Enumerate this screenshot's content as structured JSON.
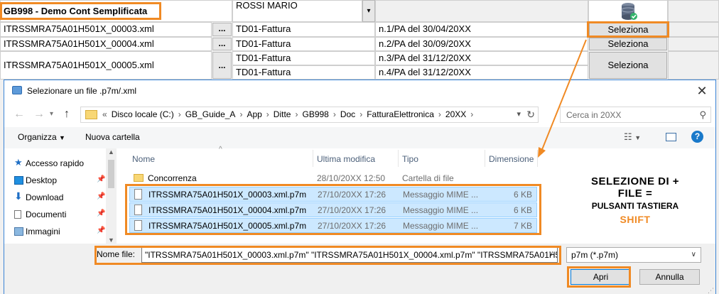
{
  "grid": {
    "company": "GB998 - Demo Cont Semplificata",
    "client": "ROSSI MARIO",
    "dots_label": "...",
    "select_label": "Seleziona",
    "rows": [
      {
        "file": "ITRSSMRA75A01H501X_00003.xml",
        "docs": [
          {
            "type": "TD01-Fattura",
            "ref": "n.1/PA del 30/04/20XX"
          }
        ]
      },
      {
        "file": "ITRSSMRA75A01H501X_00004.xml",
        "docs": [
          {
            "type": "TD01-Fattura",
            "ref": "n.2/PA del 30/09/20XX"
          }
        ]
      },
      {
        "file": "ITRSSMRA75A01H501X_00005.xml",
        "docs": [
          {
            "type": "TD01-Fattura",
            "ref": "n.3/PA del 31/12/20XX"
          },
          {
            "type": "TD01-Fattura",
            "ref": "n.4/PA del 31/12/20XX"
          }
        ]
      }
    ]
  },
  "dialog": {
    "title": "Selezionare un file .p7m/.xml",
    "breadcrumbs": [
      "Disco locale (C:)",
      "GB_Guide_A",
      "App",
      "Ditte",
      "GB998",
      "Doc",
      "FatturaElettronica",
      "20XX"
    ],
    "search_placeholder": "Cerca in 20XX",
    "toolbar": {
      "organize": "Organizza",
      "new_folder": "Nuova cartella"
    },
    "nav": [
      {
        "label": "Accesso rapido",
        "icon": "star-icon"
      },
      {
        "label": "Desktop",
        "icon": "desktop-icon"
      },
      {
        "label": "Download",
        "icon": "download-icon"
      },
      {
        "label": "Documenti",
        "icon": "documents-icon"
      },
      {
        "label": "Immagini",
        "icon": "pictures-icon"
      }
    ],
    "columns": {
      "name": "Nome",
      "modified": "Ultima modifica",
      "type": "Tipo",
      "size": "Dimensione"
    },
    "files": [
      {
        "name": "Concorrenza",
        "modified": "28/10/20XX 12:50",
        "type": "Cartella di file",
        "size": "",
        "folder": true,
        "selected": false
      },
      {
        "name": "ITRSSMRA75A01H501X_00003.xml.p7m",
        "modified": "27/10/20XX 17:26",
        "type": "Messaggio MIME ...",
        "size": "6 KB",
        "folder": false,
        "selected": true
      },
      {
        "name": "ITRSSMRA75A01H501X_00004.xml.p7m",
        "modified": "27/10/20XX 17:26",
        "type": "Messaggio MIME ...",
        "size": "6 KB",
        "folder": false,
        "selected": true
      },
      {
        "name": "ITRSSMRA75A01H501X_00005.xml.p7m",
        "modified": "27/10/20XX 17:26",
        "type": "Messaggio MIME ...",
        "size": "7 KB",
        "folder": false,
        "selected": true
      }
    ],
    "annotation": {
      "line1": "SELEZIONE DI +",
      "line2": "FILE =",
      "line3": "PULSANTI TASTIERA",
      "line4": "SHIFT"
    },
    "filename_label": "Nome file:",
    "filename_value": "\"ITRSSMRA75A01H501X_00003.xml.p7m\" \"ITRSSMRA75A01H501X_00004.xml.p7m\" \"ITRSSMRA75A01H501X_",
    "filetype": "p7m (*.p7m)",
    "open_label": "Apri",
    "cancel_label": "Annulla"
  },
  "colors": {
    "highlight": "#f08a24",
    "selection": "#cce8ff",
    "accent": "#0078d7"
  }
}
